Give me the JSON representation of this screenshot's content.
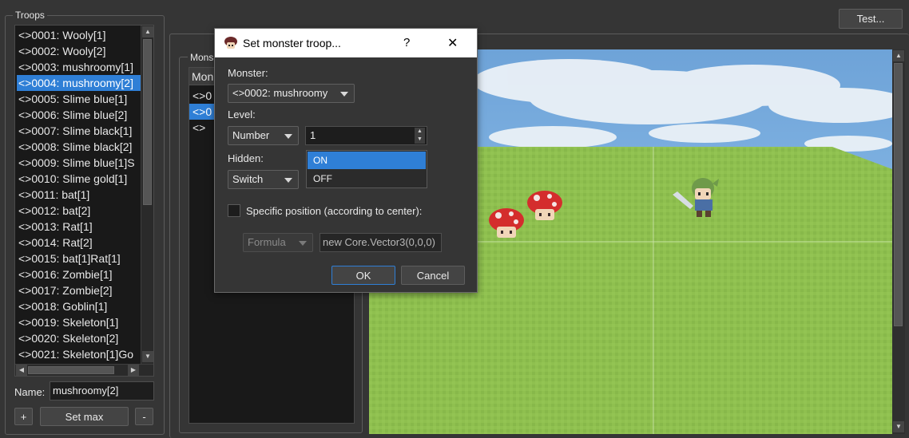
{
  "troops": {
    "title": "Troops",
    "items": [
      "<>0001: Wooly[1]",
      "<>0002: Wooly[2]",
      "<>0003: mushroomy[1]",
      "<>0004: mushroomy[2]",
      "<>0005: Slime blue[1]",
      "<>0006: Slime blue[2]",
      "<>0007: Slime black[1]",
      "<>0008: Slime black[2]",
      "<>0009: Slime blue[1]S",
      "<>0010: Slime gold[1]",
      "<>0011: bat[1]",
      "<>0012: bat[2]",
      "<>0013: Rat[1]",
      "<>0014: Rat[2]",
      "<>0015: bat[1]Rat[1]",
      "<>0016: Zombie[1]",
      "<>0017: Zombie[2]",
      "<>0018: Goblin[1]",
      "<>0019: Skeleton[1]",
      "<>0020: Skeleton[2]",
      "<>0021: Skeleton[1]Go"
    ],
    "selected_index": 3,
    "name_label": "Name:",
    "name_value": "mushroomy[2]",
    "add_label": "+",
    "set_max_label": "Set max",
    "remove_label": "-"
  },
  "monsters": {
    "title": "Mons",
    "header": "Mon",
    "rows": [
      "<>0",
      "<>0",
      "<>"
    ],
    "selected_index": 1
  },
  "test_button_label": "Test...",
  "dialog": {
    "title": "Set monster troop...",
    "help_label": "?",
    "close_label": "✕",
    "monster_label": "Monster:",
    "monster_value": "<>0002: mushroomy",
    "level_label": "Level:",
    "level_mode": "Number",
    "level_value": "1",
    "hidden_label": "Hidden:",
    "hidden_mode": "Switch",
    "hidden_options": [
      "ON",
      "OFF"
    ],
    "hidden_highlighted_index": 0,
    "position_label": "Specific position (according to center):",
    "position_checked": false,
    "position_mode": "Formula",
    "position_value": "new Core.Vector3(0,0,0)",
    "ok_label": "OK",
    "cancel_label": "Cancel"
  },
  "colors": {
    "background": "#353535",
    "selection": "#2f7fd6",
    "sky": "#7fb4e6",
    "grass": "#8fc04f"
  }
}
